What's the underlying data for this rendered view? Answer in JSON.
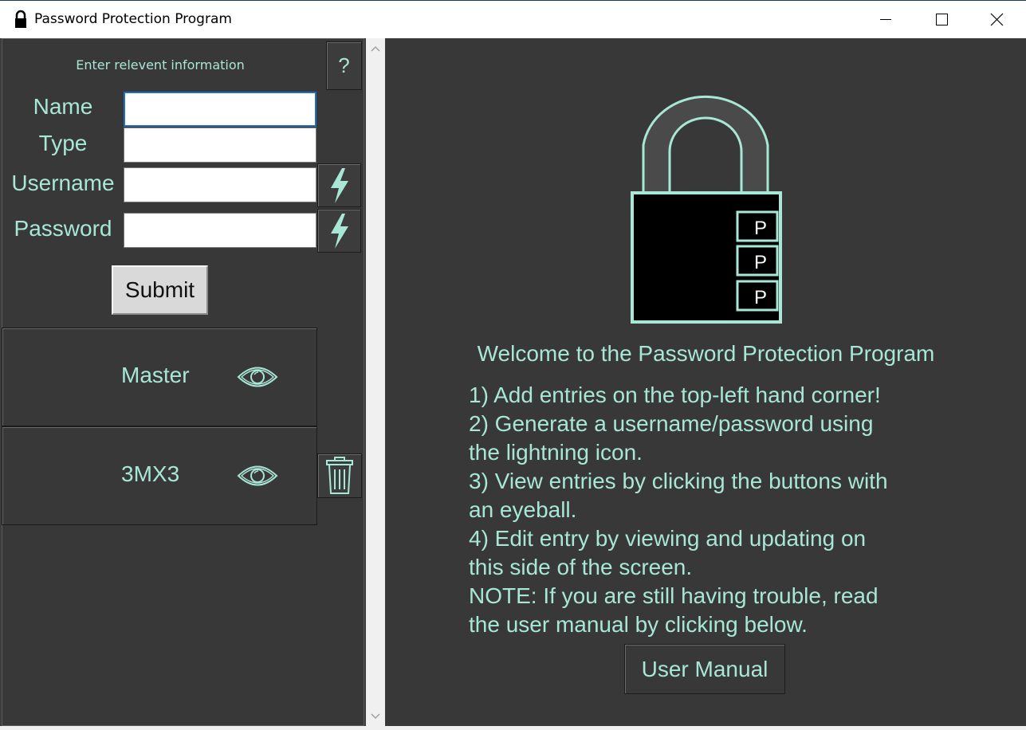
{
  "window": {
    "title": "Password Protection Program",
    "icon": "lock-icon",
    "controls": [
      "minimize-icon",
      "maximize-icon",
      "close-icon"
    ]
  },
  "form": {
    "instruction": "Enter relevent information",
    "help_label": "?",
    "fields": [
      {
        "label": "Name",
        "value": "",
        "placeholder": ""
      },
      {
        "label": "Type",
        "value": "",
        "placeholder": ""
      },
      {
        "label": "Username",
        "value": "",
        "placeholder": ""
      },
      {
        "label": "Password",
        "value": "",
        "placeholder": ""
      }
    ],
    "generate_icon": "lightning-icon",
    "submit_label": "Submit"
  },
  "entries": [
    {
      "name": "Master",
      "icon": "eye-icon"
    },
    {
      "name": "3MX3",
      "icon": "eye-icon"
    }
  ],
  "delete_icon": "trash-icon",
  "main": {
    "lock_labels": [
      "P",
      "P",
      "P"
    ],
    "welcome": "Welcome to the Password Protection Program",
    "steps": [
      "1) Add entries on the top-left hand corner!",
      "2) Generate a username/password using",
      "the lightning icon.",
      "3) View entries by clicking the buttons with",
      "an eyeball.",
      "4) Edit entry by viewing and updating on",
      "this side of the screen.",
      "NOTE: If you are still having trouble, read",
      "the user manual by clicking below."
    ],
    "manual_label": "User Manual"
  },
  "colors": {
    "accent": "#a8e6d6",
    "panel": "#383838",
    "background": "#3c3c3c"
  }
}
